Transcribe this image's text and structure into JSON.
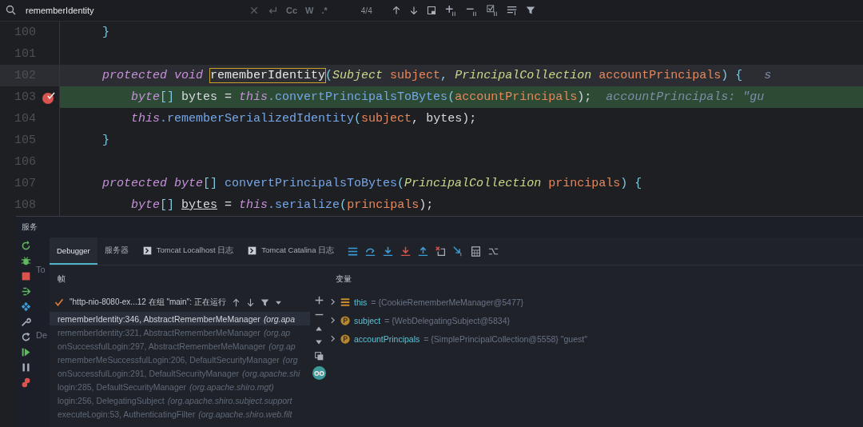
{
  "search": {
    "query": "rememberIdentity",
    "options": [
      "Cc",
      "W",
      ".*"
    ],
    "match_count": "4/4"
  },
  "editor": {
    "lines": [
      {
        "number": "100",
        "breakpoint": false,
        "execution_point": false,
        "caret_line": false,
        "tokens": [
          {
            "text": "    }",
            "kind": "punct"
          }
        ]
      },
      {
        "number": "101",
        "breakpoint": false,
        "execution_point": false,
        "caret_line": false
      },
      {
        "number": "102",
        "breakpoint": false,
        "execution_point": false,
        "caret_line": true,
        "tokens": [
          {
            "text": "    protected void ",
            "kind": "keyword"
          },
          {
            "text": "rememberIdentity",
            "kind": "match"
          },
          {
            "text": "(",
            "kind": "punct"
          },
          {
            "text": "Subject ",
            "kind": "type"
          },
          {
            "text": "subject",
            "kind": "param"
          },
          {
            "text": ", ",
            "kind": "punct"
          },
          {
            "text": "PrincipalCollection ",
            "kind": "type"
          },
          {
            "text": "accountPrincipals",
            "kind": "param"
          },
          {
            "text": ") {",
            "kind": "punct"
          },
          {
            "text": "   s",
            "kind": "hint"
          }
        ]
      },
      {
        "number": "103",
        "breakpoint": true,
        "execution_point": true,
        "caret_line": false,
        "tokens": [
          {
            "text": "        byte",
            "kind": "keyword"
          },
          {
            "text": "[] ",
            "kind": "punct"
          },
          {
            "text": "bytes = ",
            "kind": "plain"
          },
          {
            "text": "this",
            "kind": "keyword"
          },
          {
            "text": ".convertPrincipalsToBytes",
            "kind": "method"
          },
          {
            "text": "(",
            "kind": "punct"
          },
          {
            "text": "accountPrincipals",
            "kind": "param"
          },
          {
            "text": ");",
            "kind": "plain"
          },
          {
            "text": "  accountPrincipals: \"gu",
            "kind": "hint"
          }
        ]
      },
      {
        "number": "104",
        "breakpoint": false,
        "execution_point": false,
        "caret_line": false,
        "tokens": [
          {
            "text": "        this",
            "kind": "keyword"
          },
          {
            "text": ".rememberSerializedIdentity",
            "kind": "method"
          },
          {
            "text": "(",
            "kind": "punct"
          },
          {
            "text": "subject",
            "kind": "param"
          },
          {
            "text": ", ",
            "kind": "plain"
          },
          {
            "text": "bytes",
            "kind": "plain"
          },
          {
            "text": ");",
            "kind": "plain"
          }
        ]
      },
      {
        "number": "105",
        "breakpoint": false,
        "execution_point": false,
        "caret_line": false,
        "tokens": [
          {
            "text": "    }",
            "kind": "punct"
          }
        ]
      },
      {
        "number": "106",
        "breakpoint": false,
        "execution_point": false,
        "caret_line": false
      },
      {
        "number": "107",
        "breakpoint": false,
        "execution_point": false,
        "caret_line": false,
        "tokens": [
          {
            "text": "    protected byte",
            "kind": "keyword"
          },
          {
            "text": "[] ",
            "kind": "punct"
          },
          {
            "text": "convertPrincipalsToBytes",
            "kind": "method"
          },
          {
            "text": "(",
            "kind": "punct"
          },
          {
            "text": "PrincipalCollection ",
            "kind": "type"
          },
          {
            "text": "principals",
            "kind": "param"
          },
          {
            "text": ") {",
            "kind": "punct"
          }
        ]
      },
      {
        "number": "108",
        "breakpoint": false,
        "execution_point": false,
        "caret_line": false,
        "tokens": [
          {
            "text": "        byte",
            "kind": "keyword"
          },
          {
            "text": "[] ",
            "kind": "punct"
          },
          {
            "text": "bytes",
            "kind": "underlined"
          },
          {
            "text": " = ",
            "kind": "plain"
          },
          {
            "text": "this",
            "kind": "keyword"
          },
          {
            "text": ".serialize",
            "kind": "method"
          },
          {
            "text": "(",
            "kind": "punct"
          },
          {
            "text": "principals",
            "kind": "param"
          },
          {
            "text": ");",
            "kind": "plain"
          }
        ]
      }
    ]
  },
  "services_panel": {
    "title": "服务",
    "tree": [
      {
        "label": "To"
      },
      {
        "label": "De"
      }
    ]
  },
  "debugger": {
    "tabs": [
      {
        "label": "Debugger",
        "selected": true,
        "kind": "plain"
      },
      {
        "label": "服务器",
        "selected": false,
        "kind": "plain"
      },
      {
        "label": "Tomcat Localhost 日志",
        "selected": false,
        "kind": "log"
      },
      {
        "label": "Tomcat Catalina 日志",
        "selected": false,
        "kind": "log"
      }
    ],
    "frames": {
      "title": "帧",
      "thread": "\"http-nio-8080-ex...12 在组 \"main\": 正在运行",
      "items": [
        {
          "location": "rememberIdentity:346, AbstractRememberMeManager",
          "package": "(org.apa",
          "selected": true
        },
        {
          "location": "rememberIdentity:321, AbstractRememberMeManager",
          "package": "(org.ap",
          "selected": false
        },
        {
          "location": "onSuccessfulLogin:297, AbstractRememberMeManager",
          "package": "(org.ap",
          "selected": false
        },
        {
          "location": "rememberMeSuccessfulLogin:206, DefaultSecurityManager",
          "package": "(org",
          "selected": false
        },
        {
          "location": "onSuccessfulLogin:291, DefaultSecurityManager",
          "package": "(org.apache.shi",
          "selected": false
        },
        {
          "location": "login:285, DefaultSecurityManager",
          "package": "(org.apache.shiro.mgt)",
          "selected": false
        },
        {
          "location": "login:256, DelegatingSubject",
          "package": "(org.apache.shiro.subject.support",
          "selected": false
        },
        {
          "location": "executeLogin:53, AuthenticatingFilter",
          "package": "(org.apache.shiro.web.filt",
          "selected": false
        }
      ]
    },
    "variables": {
      "title": "变量",
      "items": [
        {
          "name": "this",
          "value": "= {CookieRememberMeManager@5477}",
          "kind": "field"
        },
        {
          "name": "subject",
          "value": "= {WebDelegatingSubject@5834}",
          "kind": "param"
        },
        {
          "name": "accountPrincipals",
          "value": "= {SimplePrincipalCollection@5558} \"guest\"",
          "kind": "param"
        }
      ]
    }
  }
}
